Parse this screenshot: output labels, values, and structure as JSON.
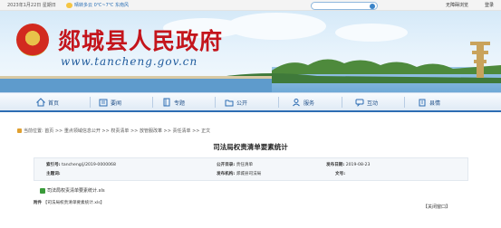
{
  "topbar": {
    "date": "2023年1月22日 星期日",
    "weather": "晴转多云 0℃~7℃ 东南风",
    "links": "无障碍浏览",
    "links2": "登录"
  },
  "banner": {
    "title": "郯城县人民政府",
    "url": "www.tancheng.gov.cn"
  },
  "nav": [
    {
      "label": "首页",
      "icon": "home-icon"
    },
    {
      "label": "要闻",
      "icon": "newspaper-icon"
    },
    {
      "label": "专题",
      "icon": "book-icon"
    },
    {
      "label": "公开",
      "icon": "folder-icon"
    },
    {
      "label": "服务",
      "icon": "person-icon"
    },
    {
      "label": "互动",
      "icon": "chat-icon"
    },
    {
      "label": "县情",
      "icon": "building-icon"
    }
  ],
  "breadcrumb": "当前位置: 首页 >> 重点领域信息公开 >> 权责清单 >> 放管服改革 >> 责任清单 >> 正文",
  "page_title": "司法局权责清单要素统计",
  "meta": {
    "index_label": "索引号:",
    "index_value": "tancheng/j/2019-0000068",
    "category_label": "公开目录:",
    "category_value": "责任清单",
    "date_label": "发布日期:",
    "date_value": "2019-08-23",
    "org_label": "主题词:",
    "org_value": "",
    "publisher_label": "发布机构:",
    "publisher_value": "郯城县司法局",
    "docno_label": "文号:",
    "docno_value": ""
  },
  "attachment": {
    "file_name": "司法局权责清单要素统计.xls",
    "note_label": "附件",
    "note_value": "【司法局权责清单要素统计.xls】"
  },
  "close_label": "【关闭窗口】"
}
